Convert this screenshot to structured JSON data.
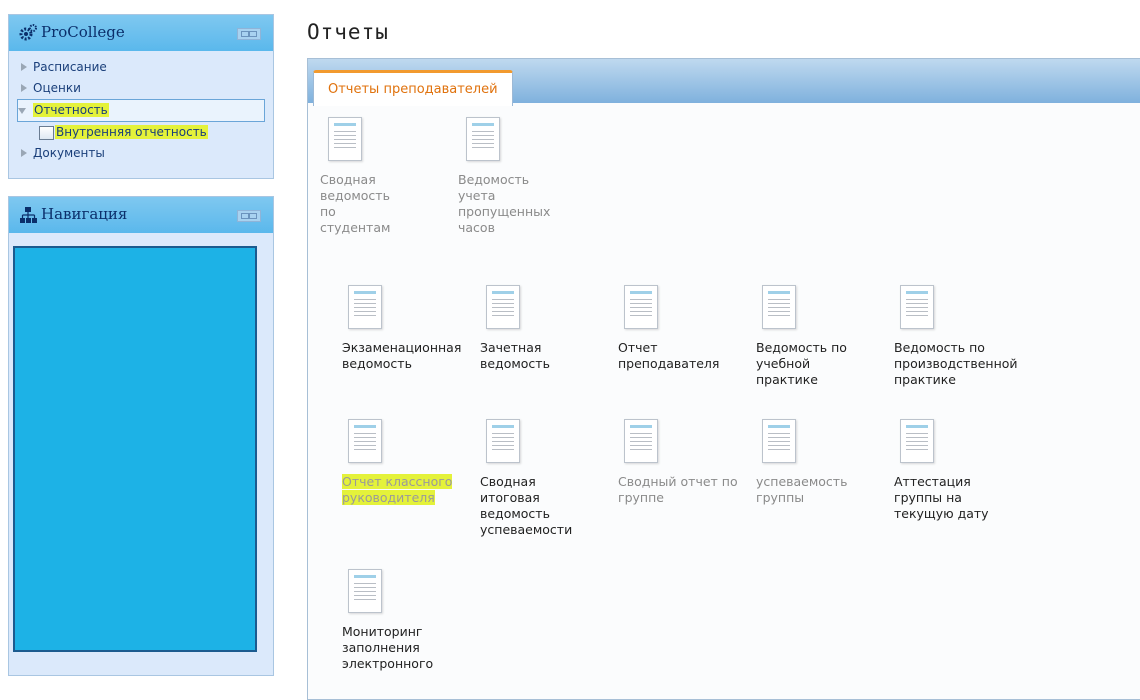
{
  "sidebar": {
    "block1": {
      "title": "ProCollege",
      "icon": "gears-icon",
      "items": [
        {
          "label": "Расписание"
        },
        {
          "label": "Оценки"
        },
        {
          "label": "Отчетность"
        },
        {
          "label": "Внутренняя отчетность"
        },
        {
          "label": "Документы"
        }
      ]
    },
    "block2": {
      "title": "Навигация",
      "icon": "sitemap-icon",
      "redacted_color": "#1db2e6"
    }
  },
  "main": {
    "title": "Отчеты",
    "tab": "Отчеты преподавателей",
    "accent": "#e0720d",
    "reports": [
      {
        "label": "Сводная ведомость по студентам"
      },
      {
        "label": "Ведомость учета пропущенных часов"
      },
      {
        "label": "Экзаменационная ведомость"
      },
      {
        "label": "Зачетная ведомость"
      },
      {
        "label": "Отчет преподавателя"
      },
      {
        "label": "Ведомость по учебной практике"
      },
      {
        "label": "Ведомость по производственной практике"
      },
      {
        "label": "Отчет классного руководителя"
      },
      {
        "label": "Сводная итоговая ведомость успеваемости"
      },
      {
        "label": "Сводный отчет по группе"
      },
      {
        "label": "успеваемость группы"
      },
      {
        "label": "Аттестация группы на текущую дату"
      },
      {
        "label": "Мониторинг заполнения электронного"
      }
    ]
  }
}
